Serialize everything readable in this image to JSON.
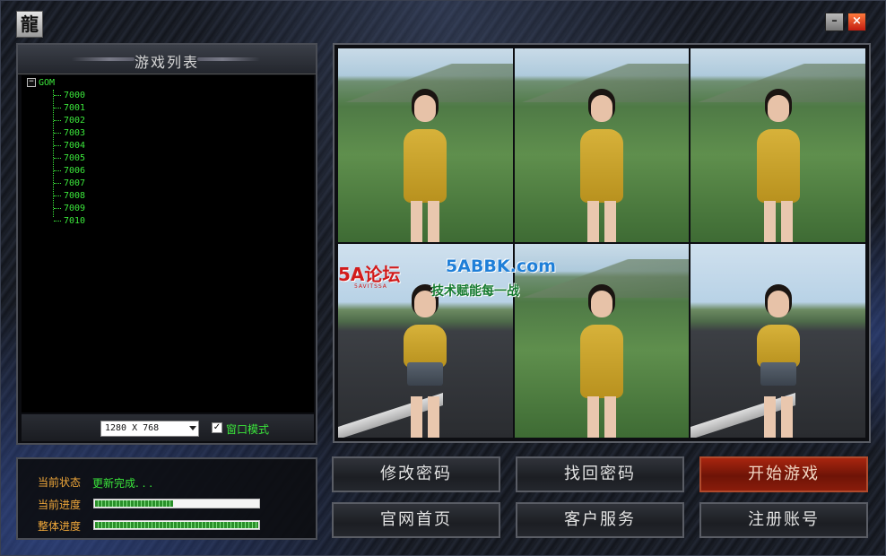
{
  "window": {
    "logo_char": "龍",
    "minimize_glyph": "–",
    "close_glyph": "×"
  },
  "game_list": {
    "title": "游戏列表",
    "root": {
      "toggle": "−",
      "label": "GOM"
    },
    "servers": [
      "7000",
      "7001",
      "7002",
      "7003",
      "7004",
      "7005",
      "7006",
      "7007",
      "7008",
      "7009",
      "7010"
    ]
  },
  "display": {
    "resolution": "1280 X 768",
    "window_mode_checked": true,
    "window_mode_mark": "✓",
    "window_mode_label": "窗口模式"
  },
  "watermark": {
    "logo": "5A论坛",
    "logo_sub": "5AVITSSA",
    "site": "5ABBK.com",
    "slogan": "技术赋能每一战"
  },
  "status": {
    "state_label": "当前状态",
    "state_value": "更新完成. . .",
    "current_label": "当前进度",
    "current_progress": 0.48,
    "total_label": "整体进度",
    "total_progress": 1.0
  },
  "buttons": {
    "change_password": "修改密码",
    "recover_password": "找回密码",
    "start_game": "开始游戏",
    "homepage": "官网首页",
    "customer_service": "客户服务",
    "register": "注册账号"
  },
  "colors": {
    "tree_text": "#3be83b",
    "status_label": "#f0a83a",
    "start_button": "#8a1c0b"
  }
}
